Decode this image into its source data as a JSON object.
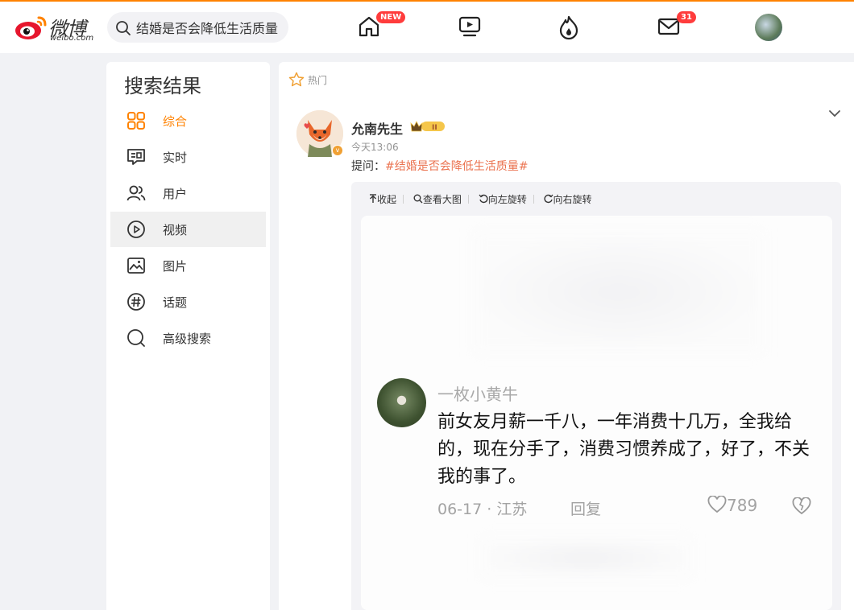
{
  "header": {
    "logo_text": "微博",
    "logo_sub": "weibo.com",
    "search_value": "结婚是否会降低生活质量",
    "home_badge": "NEW",
    "mail_badge": "31"
  },
  "sidebar": {
    "title": "搜索结果",
    "items": [
      {
        "label": "综合",
        "icon": "grid-icon"
      },
      {
        "label": "实时",
        "icon": "message-icon"
      },
      {
        "label": "用户",
        "icon": "users-icon"
      },
      {
        "label": "视频",
        "icon": "play-icon"
      },
      {
        "label": "图片",
        "icon": "image-icon"
      },
      {
        "label": "话题",
        "icon": "hashtag-icon"
      },
      {
        "label": "高级搜索",
        "icon": "search-icon"
      }
    ]
  },
  "main": {
    "section_label": "热门",
    "post": {
      "username": "允南先生",
      "time": "今天13:06",
      "text_prefix": "提问：",
      "tag": "#结婚是否会降低生活质量#",
      "tools": [
        "收起",
        "查看大图",
        "向左旋转",
        "向右旋转"
      ]
    },
    "embedded_comment": {
      "name": "一枚小黄牛",
      "body": "前女友月薪一千八，一年消费十几万，全我给的，现在分手了，消费习惯养成了，好了，不关我的事了。",
      "meta": "06-17 · 江苏",
      "reply": "回复",
      "likes": "789"
    }
  },
  "colors": {
    "accent": "#ff8200",
    "tag": "#eb7350",
    "badge": "#ff3c3c"
  }
}
